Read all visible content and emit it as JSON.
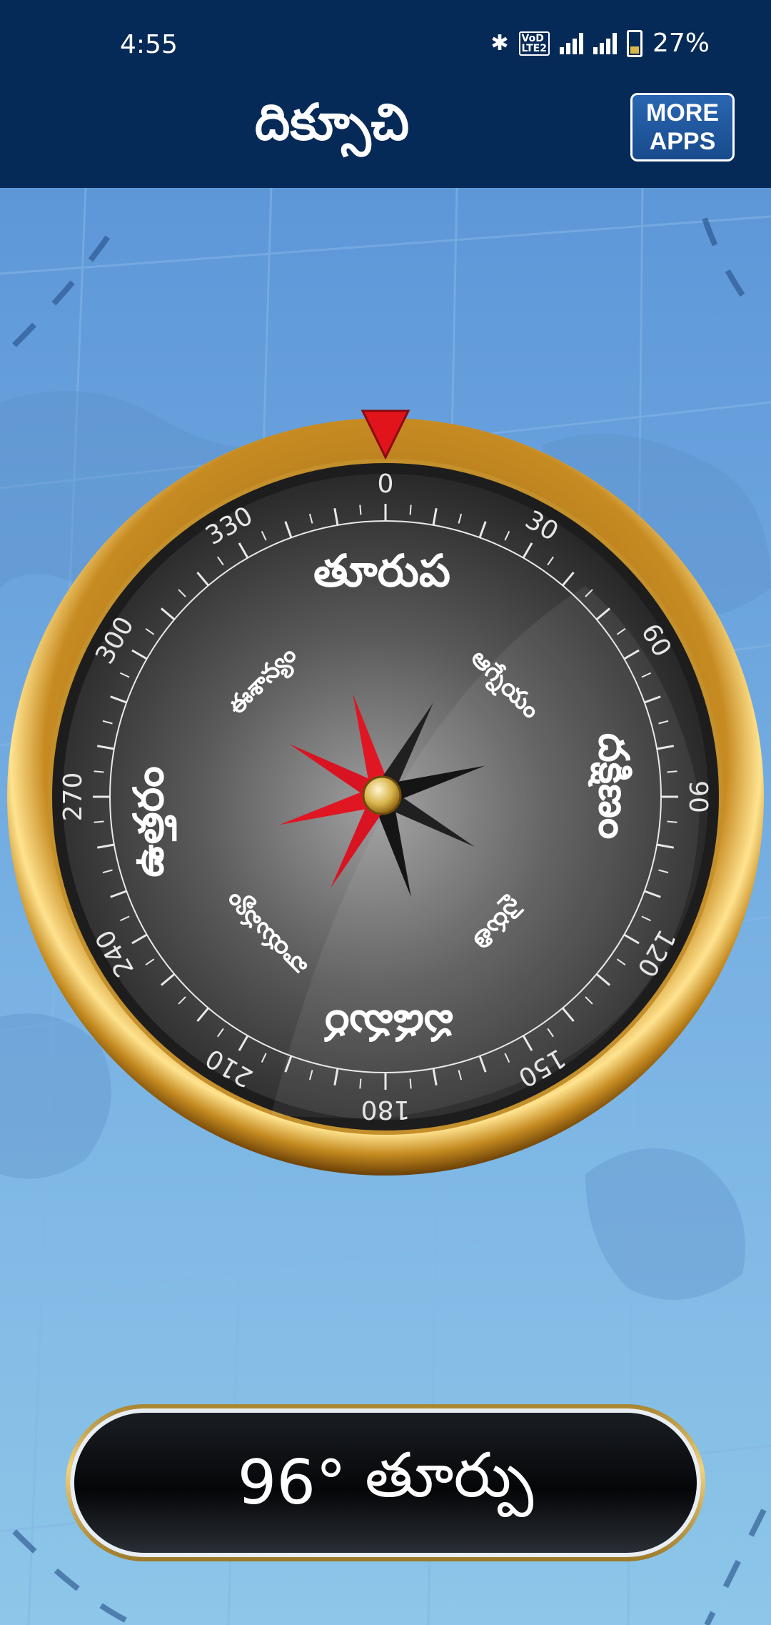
{
  "status_bar": {
    "time": "4:55",
    "battery_percent": "27%",
    "icons": [
      "bluetooth-icon",
      "volte-icon",
      "signal-icon",
      "signal-icon",
      "battery-icon"
    ],
    "volte_label_top": "VoD",
    "volte_label_bottom": "LTE2"
  },
  "app_bar": {
    "title": "దిక్సూచి",
    "more_apps_line1": "MORE",
    "more_apps_line2": "APPS"
  },
  "compass": {
    "heading_degrees": 96,
    "marker_color": "#e0141a",
    "bezel_color": "#d9a640",
    "dial_ticks": [
      "0",
      "30",
      "60",
      "90",
      "120",
      "150",
      "180",
      "210",
      "240",
      "270",
      "300",
      "330"
    ],
    "directions": {
      "top": "తూరుప",
      "right": "దక్షిణం",
      "bottom": "పడమర",
      "left": "ఉత్తరం",
      "top_right": "ఆగ్నేయం",
      "bottom_right": "నైరుతి",
      "bottom_left": "వాయువ్యం",
      "top_left": "ఈశాన్యం"
    }
  },
  "heading_display": {
    "degrees": "96°",
    "direction": "తూర్పు"
  }
}
